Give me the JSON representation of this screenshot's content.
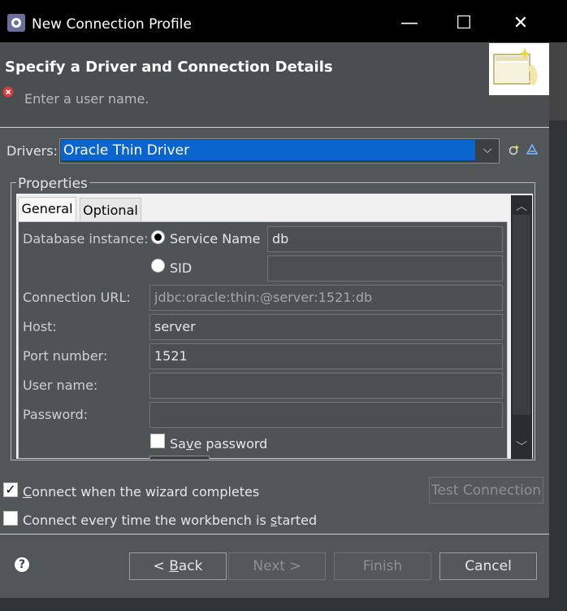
{
  "window": {
    "title": "New Connection Profile"
  },
  "header": {
    "title": "Specify a Driver and Connection Details",
    "message": "Enter a user name."
  },
  "drivers": {
    "label": "Drivers:",
    "selected": "Oracle Thin Driver"
  },
  "properties": {
    "legend": "Properties",
    "tabs": [
      "General",
      "Optional"
    ],
    "database_instance_label": "Database instance:",
    "service_name": {
      "label": "Service Name",
      "value": "db",
      "selected": true
    },
    "sid": {
      "label": "SID",
      "value": "",
      "selected": false
    },
    "connection_url": {
      "label": "Connection URL:",
      "value": "jdbc:oracle:thin:@server:1521:db"
    },
    "host": {
      "label": "Host:",
      "value": "server"
    },
    "port": {
      "label": "Port number:",
      "value": "1521"
    },
    "user_name": {
      "label": "User name:",
      "value": ""
    },
    "password": {
      "label": "Password:",
      "value": ""
    },
    "save_password": {
      "label_pre": "Sa",
      "label_u": "v",
      "label_post": "e password",
      "checked": false
    }
  },
  "options": {
    "connect_on_finish": {
      "label_u": "C",
      "label_rest": "onnect when the wizard completes",
      "checked": true
    },
    "connect_every_time": {
      "label_pre": "Connect every time the workbench is ",
      "label_u": "s",
      "label_post": "tarted",
      "checked": false
    },
    "test_connection": "Test Connection"
  },
  "buttons": {
    "back_pre": "< ",
    "back_u": "B",
    "back_post": "ack",
    "next": "Next >",
    "finish": "Finish",
    "cancel": "Cancel"
  }
}
